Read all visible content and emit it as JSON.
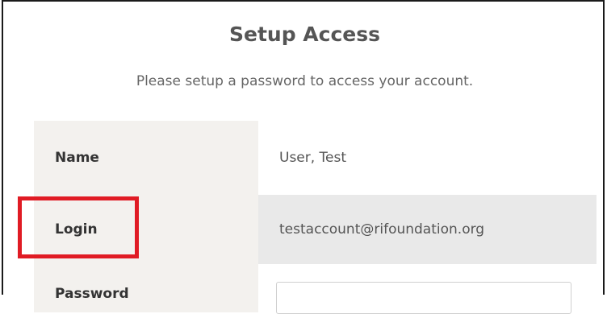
{
  "header": {
    "title": "Setup Access",
    "subtitle": "Please setup a password to access your account."
  },
  "fields": {
    "name": {
      "label": "Name",
      "value": "User, Test"
    },
    "login": {
      "label": "Login",
      "value": "testaccount@rifoundation.org"
    },
    "password": {
      "label": "Password",
      "value": ""
    }
  },
  "annotation": {
    "color": "#e01b24",
    "target": "login-label"
  }
}
